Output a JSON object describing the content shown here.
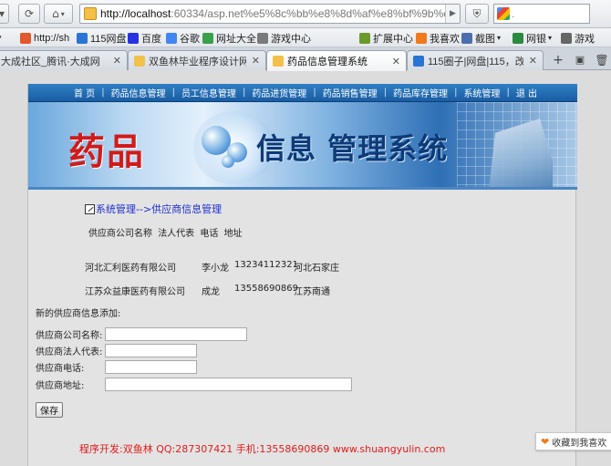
{
  "browser": {
    "url_host": "http://localhost",
    "url_rest": ":60334/asp.net%e5%8c%bb%e8%8d%af%e8%bf%9b%e9",
    "search_value": ".",
    "bookmarks": [
      {
        "label": "http://sh",
        "color": "#e3572c"
      },
      {
        "label": "115网盘",
        "color": "#2a74d6"
      },
      {
        "label": "百度",
        "color": "#2932e1"
      },
      {
        "label": "谷歌",
        "color": "#4285f4"
      },
      {
        "label": "网址大全",
        "color": "#3aa04a"
      },
      {
        "label": "游戏中心",
        "color": "#7a7a7a"
      },
      {
        "label": "扩展中心",
        "color": "#6b9a2c"
      },
      {
        "label": "我喜欢",
        "color": "#f07a1c"
      },
      {
        "label": "截图",
        "color": "#4a6fb0"
      },
      {
        "label": "网银",
        "color": "#2b8a3e"
      },
      {
        "label": "游戏",
        "color": "#666666"
      }
    ],
    "tabs": [
      {
        "label": "大成社区_腾讯·大成网",
        "active": false,
        "color": "#d9d9d9"
      },
      {
        "label": "双鱼林毕业程序设计网 [...",
        "active": false,
        "color": "#f3c14a"
      },
      {
        "label": "药品信息管理系统",
        "active": true,
        "color": "#f3c14a"
      },
      {
        "label": "115圈子|网盘|115，改...",
        "active": false,
        "color": "#2a74d6"
      }
    ],
    "close_glyph": "✕",
    "new_tab_glyph": "+"
  },
  "nav": {
    "items": [
      "首 页",
      "药品信息管理",
      "员工信息管理",
      "药品进货管理",
      "药品销售管理",
      "药品库存管理",
      "系统管理",
      "退 出"
    ],
    "separator": "|"
  },
  "banner": {
    "title_red": "药品",
    "title_blue": "信息 管理系统"
  },
  "breadcrumb": "系统管理-->供应商信息管理",
  "table": {
    "headers": [
      "供应商公司名称",
      "法人代表",
      "电话",
      "地址"
    ],
    "rows": [
      [
        "河北汇利医药有限公司",
        "李小龙",
        "13234112321",
        "河北石家庄"
      ],
      [
        "江苏众益康医药有限公司",
        "成龙",
        "13558690869",
        "江苏南通"
      ]
    ]
  },
  "form": {
    "title": "新的供应商信息添加:",
    "fields": [
      {
        "label": "供应商公司名称:",
        "value": ""
      },
      {
        "label": "供应商法人代表:",
        "value": ""
      },
      {
        "label": "供应商电话:",
        "value": ""
      },
      {
        "label": "供应商地址:",
        "value": ""
      }
    ],
    "submit_label": "保存"
  },
  "footer": "程序开发:双鱼林 QQ:287307421 手机:13558690869 www.shuangyulin.com",
  "favorite_widget": "收藏到我喜欢"
}
